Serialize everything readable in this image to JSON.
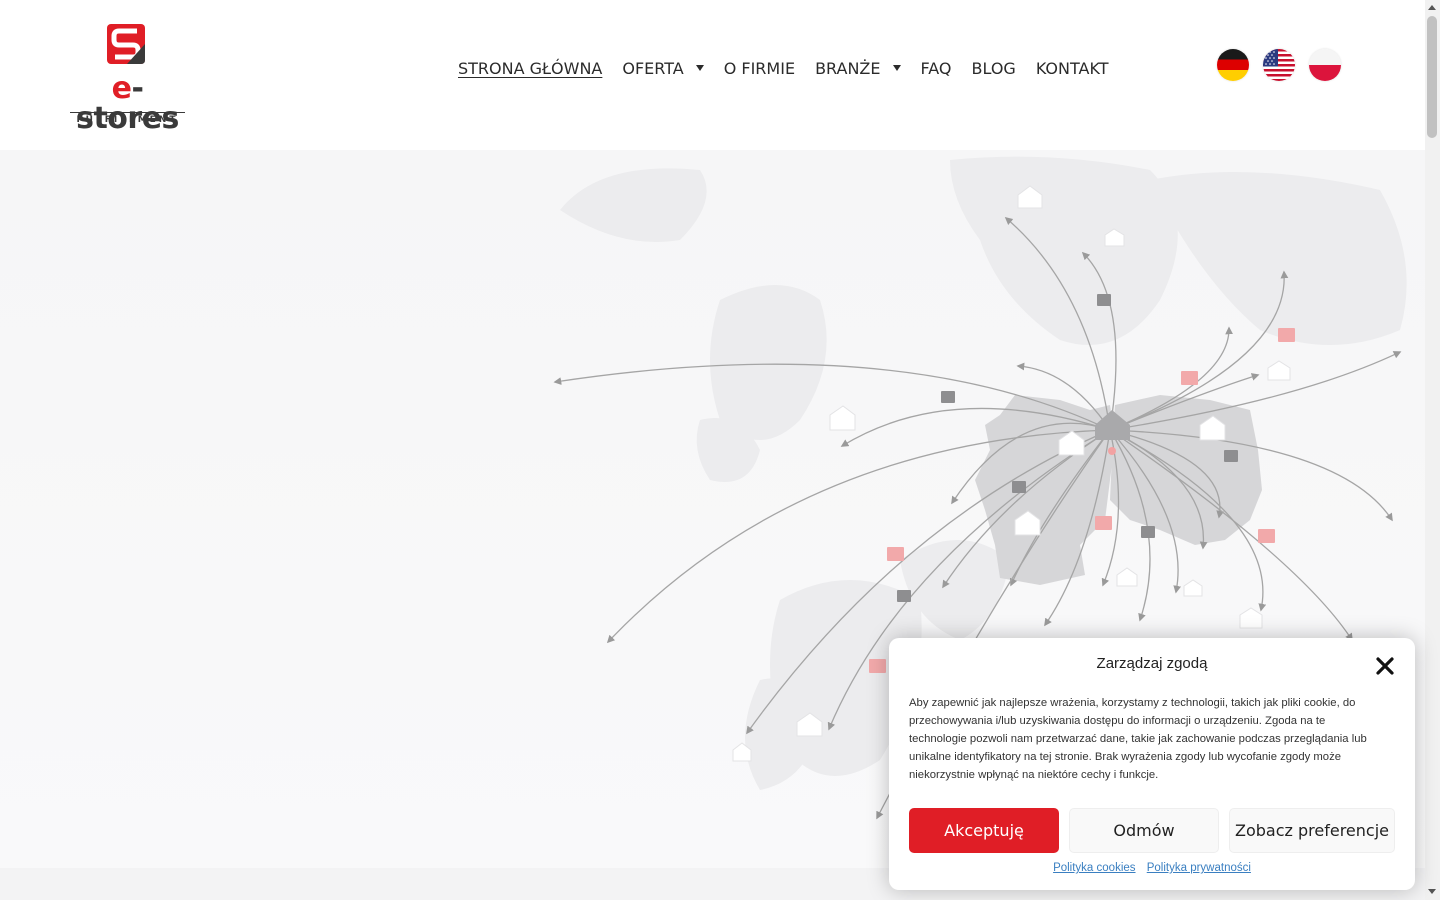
{
  "header": {
    "logo": {
      "wordmark_prefix": "e",
      "wordmark_rest": "-stores",
      "subtitle": "FULFILLMENT"
    },
    "nav": [
      {
        "label": "STRONA GŁÓWNA",
        "active": true,
        "has_dropdown": false
      },
      {
        "label": "OFERTA",
        "active": false,
        "has_dropdown": true
      },
      {
        "label": "O FIRMIE",
        "active": false,
        "has_dropdown": false
      },
      {
        "label": "BRANŻE",
        "active": false,
        "has_dropdown": true
      },
      {
        "label": "FAQ",
        "active": false,
        "has_dropdown": false
      },
      {
        "label": "BLOG",
        "active": false,
        "has_dropdown": false
      },
      {
        "label": "KONTAKT",
        "active": false,
        "has_dropdown": false
      }
    ],
    "flags": [
      "germany-flag",
      "usa-flag",
      "poland-flag"
    ]
  },
  "consent": {
    "title": "Zarządzaj zgodą",
    "body": "Aby zapewnić jak najlepsze wrażenia, korzystamy z technologii, takich jak pliki cookie, do przechowywania i/lub uzyskiwania dostępu do informacji o urządzeniu. Zgoda na te technologie pozwoli nam przetwarzać dane, takie jak zachowanie podczas przeglądania lub unikalne identyfikatory na tej stronie. Brak wyrażenia zgody lub wycofanie zgody może niekorzystnie wpłynąć na niektóre cechy i funkcje.",
    "accept_label": "Akceptuję",
    "deny_label": "Odmów",
    "prefs_label": "Zobacz preferencje",
    "cookie_policy_label": "Polityka cookies",
    "privacy_policy_label": "Polityka prywatności"
  },
  "colors": {
    "brand_red": "#e01e26",
    "text_dark": "#2b2b2b",
    "link_blue": "#3a7fc1"
  }
}
